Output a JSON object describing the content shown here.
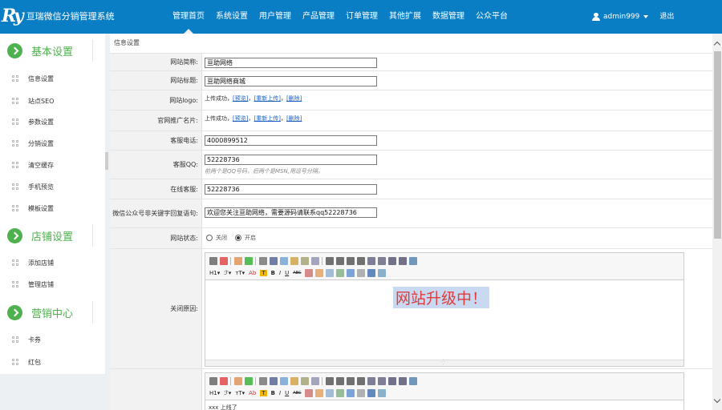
{
  "app": {
    "logo_mark": "Ry",
    "title": "亘瑞微信分销管理系统"
  },
  "nav": {
    "items": [
      "管理首页",
      "系统设置",
      "用户管理",
      "产品管理",
      "订单管理",
      "其他扩展",
      "数据管理",
      "公众平台"
    ],
    "active_index": 0
  },
  "user": {
    "name": "admin999",
    "logout": "退出"
  },
  "sidebar": {
    "groups": [
      {
        "title": "基本设置",
        "items": [
          "信息设置",
          "站点SEO",
          "参数设置",
          "分销设置",
          "清空缓存",
          "手机预览",
          "模板设置"
        ]
      },
      {
        "title": "店铺设置",
        "items": [
          "添加店铺",
          "管理店铺"
        ]
      },
      {
        "title": "营销中心",
        "items": [
          "卡券",
          "红包"
        ]
      }
    ]
  },
  "breadcrumb": "信息设置",
  "form": {
    "site_name": {
      "label": "网站简称:",
      "value": "亘助网络"
    },
    "site_title": {
      "label": "网站标题:",
      "value": "亘助网络商城"
    },
    "site_logo": {
      "label": "网站logo:",
      "status": "上传成功，",
      "preview": "[预览]",
      "reupload": "[重新上传]",
      "delete": "[删除]",
      "sep": "，"
    },
    "promo_card": {
      "label": "官网推广名片:",
      "status": "上传成功，",
      "preview": "[预览]",
      "reupload": "[重新上传]",
      "delete": "[删除]",
      "sep": "，"
    },
    "phone": {
      "label": "客服电话:",
      "value": "4000899512"
    },
    "qq": {
      "label": "客服QQ:",
      "value": "52228736",
      "hint": "前两个是QQ号码，后两个是MSN,用逗号分隔。"
    },
    "online_service": {
      "label": "在线客服:",
      "value": "52228736"
    },
    "wechat_reply": {
      "label": "微信公众号非关键字回复语句:",
      "value": "欢迎您关注亘助网络，需要源码请联系qq52228736"
    },
    "site_status": {
      "label": "网站状态:",
      "options": [
        "关闭",
        "开启"
      ],
      "selected": 1
    },
    "close_reason": {
      "label": "关闭原因:",
      "content": "网站升级中！"
    },
    "editor2": {
      "content": "xxx 上线了"
    }
  },
  "editor_toolbar": {
    "row1_icons": [
      "source-icon",
      "preview-icon",
      "undo-icon",
      "redo-icon",
      "print-icon",
      "cut-icon",
      "copy-icon",
      "paste-icon",
      "paste-text-icon",
      "paste-word-icon",
      "align-left-icon",
      "align-center-icon",
      "align-right-icon",
      "justify-icon",
      "ordered-list-icon",
      "bullet-list-icon",
      "indent-icon",
      "outdent-icon",
      "select-all-icon"
    ],
    "heading": "H1",
    "font_family": "ℱ",
    "font_size": "тT",
    "row2_text": [
      "Ab",
      "T",
      "B",
      "I",
      "U",
      "ABC"
    ],
    "row2_icons": [
      "eraser-icon",
      "image-icon",
      "flash-icon",
      "media-icon",
      "table-icon",
      "hr-icon",
      "link-icon",
      "unlink-icon"
    ]
  },
  "colors": {
    "header": "#0a7ec4",
    "accent_green": "#4db14d",
    "notice_red": "#e03c3c"
  }
}
